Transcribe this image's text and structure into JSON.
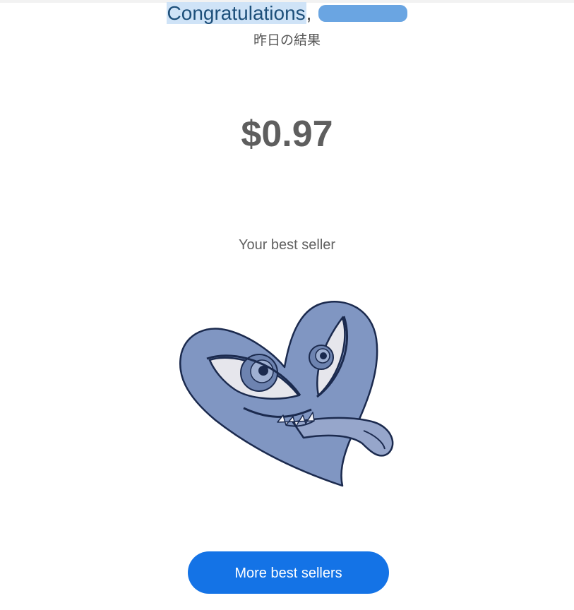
{
  "header": {
    "greeting_word": "Congratulations",
    "comma": ","
  },
  "subtitle": "昨日の結果",
  "earnings": {
    "amount": "$0.97"
  },
  "best_seller": {
    "label": "Your best seller",
    "image_icon": "grinning-heart-sticker-icon"
  },
  "actions": {
    "more_label": "More best sellers"
  },
  "colors": {
    "accent": "#1473e6",
    "heart": "#8096c2",
    "outline": "#1b2a4e"
  }
}
